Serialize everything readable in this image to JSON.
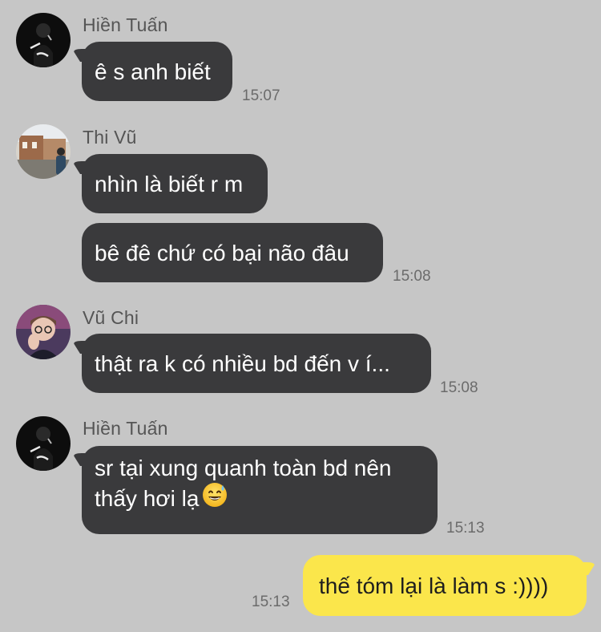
{
  "messages": [
    {
      "sender": "Hiền Tuấn",
      "bubbles": [
        "ê s anh biết"
      ],
      "time": "15:07"
    },
    {
      "sender": "Thi Vũ",
      "bubbles": [
        "nhìn là biết r m",
        "bê đê chứ có bại não đâu"
      ],
      "time": "15:08"
    },
    {
      "sender": "Vũ Chi",
      "bubbles": [
        "thật ra k có nhiều bd đến v í..."
      ],
      "time": "15:08"
    },
    {
      "sender": "Hiền Tuấn",
      "bubbles": [
        "sr tại xung quanh toàn bd nên",
        "thấy hơi lạ"
      ],
      "emoji": "grinning-face-with-sweat-icon",
      "time": "15:13"
    }
  ],
  "my_message": {
    "text": "thế tóm lại là làm s :))))",
    "time": "15:13"
  },
  "colors": {
    "background": "#c6c6c6",
    "incoming_bubble": "#3a3a3c",
    "outgoing_bubble": "#fbe64b"
  }
}
